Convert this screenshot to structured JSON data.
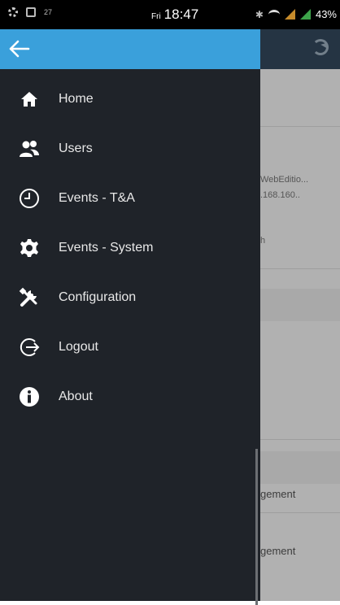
{
  "status_bar": {
    "left_indicator": "27",
    "day": "Fri",
    "time": "18:47",
    "battery": "43%"
  },
  "drawer": {
    "back_icon": "arrow-left-icon",
    "accent_color": "#3aa0db",
    "background_color": "#1f2329",
    "items": [
      {
        "label": "Home",
        "icon": "home-icon"
      },
      {
        "label": "Users",
        "icon": "users-icon"
      },
      {
        "label": "Events - T&A",
        "icon": "clock-icon"
      },
      {
        "label": "Events - System",
        "icon": "gear-icon"
      },
      {
        "label": "Configuration",
        "icon": "tools-icon"
      },
      {
        "label": "Logout",
        "icon": "logout-icon"
      },
      {
        "label": "About",
        "icon": "info-icon"
      }
    ]
  },
  "background_app": {
    "refresh_icon": "refresh-icon",
    "edition_text": "WebEditio...",
    "ip_text": ".168.160..",
    "h_text": "h",
    "row1_text": "gement",
    "row2_text": "gement"
  }
}
